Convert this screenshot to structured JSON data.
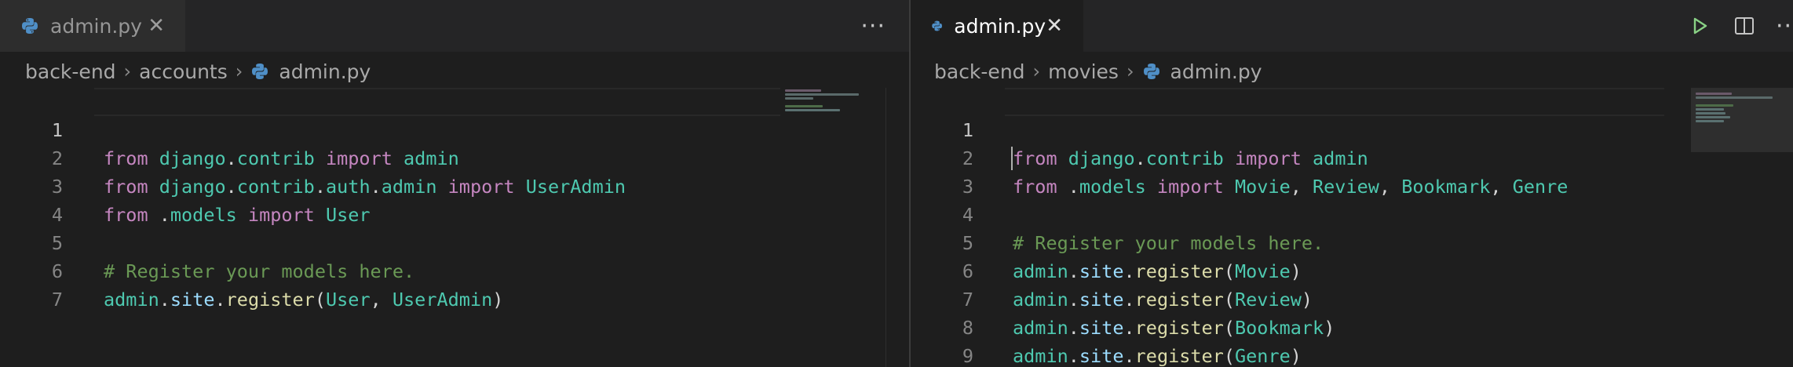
{
  "left": {
    "tab": {
      "label": "admin.py",
      "close": "✕"
    },
    "more": "···",
    "breadcrumb": [
      "back-end",
      "accounts",
      "admin.py"
    ],
    "lines": [
      "1",
      "2",
      "3",
      "4",
      "5",
      "6",
      "7"
    ]
  },
  "right": {
    "tab": {
      "label": "admin.py",
      "close": "✕"
    },
    "more": "···",
    "breadcrumb": [
      "back-end",
      "movies",
      "admin.py"
    ],
    "lines": [
      "1",
      "2",
      "3",
      "4",
      "5",
      "6",
      "7",
      "8",
      "9"
    ]
  },
  "code_left": {
    "l1": {
      "a": "from",
      "b": " django",
      "c": ".",
      "d": "contrib",
      "e": " import",
      "f": " admin"
    },
    "l2": {
      "a": "from",
      "b": " django",
      "c": ".",
      "d": "contrib",
      "e": ".",
      "f": "auth",
      "g": ".",
      "h": "admin",
      "i": " import",
      "j": " UserAdmin"
    },
    "l3": {
      "a": "from",
      "b": " .",
      "c": "models",
      "d": " import",
      "e": " User"
    },
    "l5": {
      "a": "# Register your models here."
    },
    "l6": {
      "a": "admin",
      "b": ".",
      "c": "site",
      "d": ".",
      "e": "register",
      "f": "(",
      "g": "User",
      "h": ", ",
      "i": "UserAdmin",
      "j": ")"
    }
  },
  "code_right": {
    "l1": {
      "a": "from",
      "b": " django",
      "c": ".",
      "d": "contrib",
      "e": " import",
      "f": " admin"
    },
    "l2": {
      "a": "from",
      "b": " .",
      "c": "models",
      "d": " import",
      "e": " Movie",
      "f": ", ",
      "g": "Review",
      "h": ", ",
      "i": "Bookmark",
      "j": ", ",
      "k": "Genre"
    },
    "l4": {
      "a": "# Register your models here."
    },
    "l5": {
      "a": "admin",
      "b": ".",
      "c": "site",
      "d": ".",
      "e": "register",
      "f": "(",
      "g": "Movie",
      "h": ")"
    },
    "l6": {
      "a": "admin",
      "b": ".",
      "c": "site",
      "d": ".",
      "e": "register",
      "f": "(",
      "g": "Review",
      "h": ")"
    },
    "l7": {
      "a": "admin",
      "b": ".",
      "c": "site",
      "d": ".",
      "e": "register",
      "f": "(",
      "g": "Bookmark",
      "h": ")"
    },
    "l8": {
      "a": "admin",
      "b": ".",
      "c": "site",
      "d": ".",
      "e": "register",
      "f": "(",
      "g": "Genre",
      "h": ")"
    }
  },
  "colors": {
    "keyword": "#c586c0",
    "module": "#4ec9b0",
    "variable": "#9cdcfe",
    "function": "#dcdcaa",
    "comment": "#6a9955",
    "run": "#89d185"
  }
}
